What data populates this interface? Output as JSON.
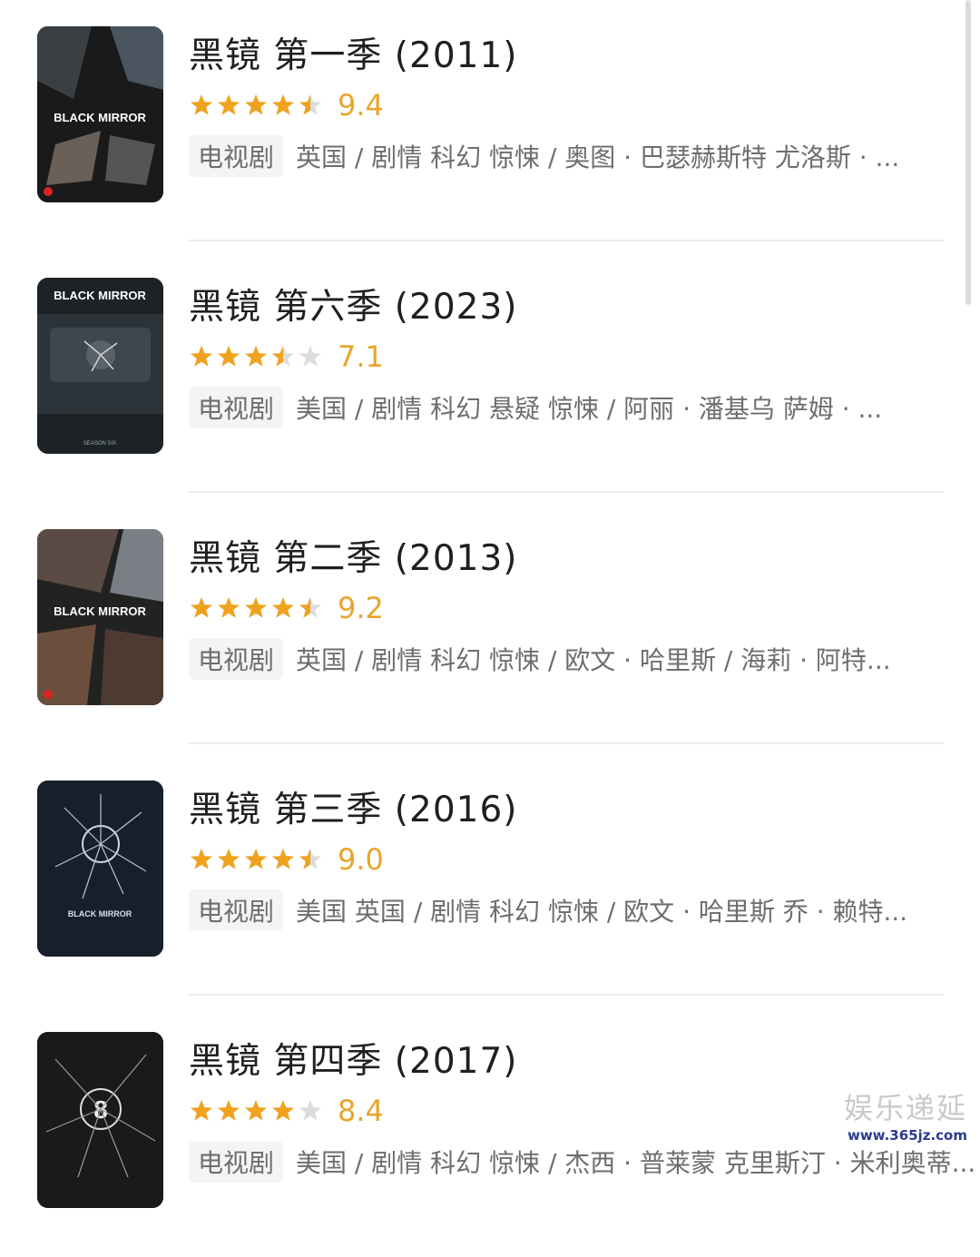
{
  "accent_color": "#f0a21d",
  "star_empty_color": "#dcdcdc",
  "items": [
    {
      "title": "黑镜 第一季 (2011)",
      "score": "9.4",
      "rating_stars": 4.5,
      "type_chip": "电视剧",
      "info": "英国 / 剧情 科幻 惊悚 / 奥图 · 巴瑟赫斯特 尤洛斯 · ...",
      "poster_text": "BLACK MIRROR"
    },
    {
      "title": "黑镜 第六季 (2023)",
      "score": "7.1",
      "rating_stars": 3.5,
      "type_chip": "电视剧",
      "info": "美国 / 剧情 科幻 悬疑 惊悚 / 阿丽 · 潘基乌 萨姆 · ...",
      "poster_text": "BLACK MIRROR"
    },
    {
      "title": "黑镜 第二季 (2013)",
      "score": "9.2",
      "rating_stars": 4.5,
      "type_chip": "电视剧",
      "info": "英国 / 剧情 科幻 惊悚 / 欧文 · 哈里斯 / 海莉 · 阿特...",
      "poster_text": "BLACK MIRROR"
    },
    {
      "title": "黑镜 第三季 (2016)",
      "score": "9.0",
      "rating_stars": 4.5,
      "type_chip": "电视剧",
      "info": "美国 英国 / 剧情 科幻 惊悚 / 欧文 · 哈里斯 乔 · 赖特...",
      "poster_text": "BLACK MIRROR"
    },
    {
      "title": "黑镜 第四季 (2017)",
      "score": "8.4",
      "rating_stars": 4,
      "type_chip": "电视剧",
      "info": "美国 / 剧情 科幻 惊悚 / 杰西 · 普莱蒙 克里斯汀 · 米利奥蒂...",
      "poster_text": ""
    }
  ],
  "watermark": {
    "main": "娱乐递延",
    "url": "www.365jz.com"
  }
}
